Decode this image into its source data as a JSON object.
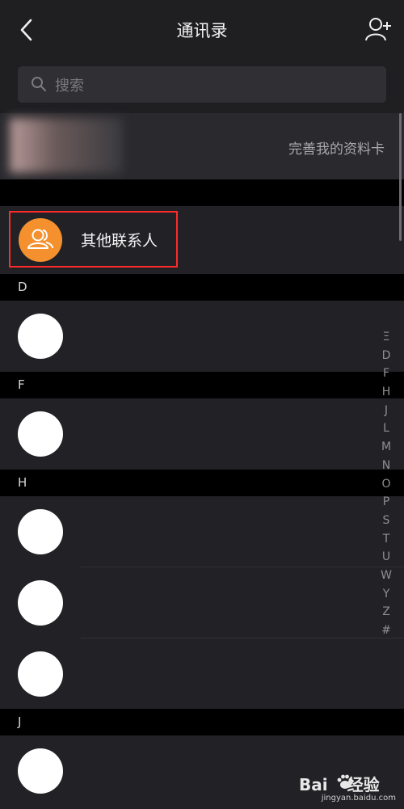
{
  "header": {
    "title": "通讯录",
    "back_icon": "chevron-left-icon",
    "add_icon": "add-contact-icon"
  },
  "search": {
    "placeholder": "搜索"
  },
  "profile": {
    "cta": "完善我的资料卡"
  },
  "other_contacts": {
    "label": "其他联系人",
    "highlight_color": "#ff2a2a",
    "avatar_color": "#f4912e"
  },
  "sections": [
    {
      "letter": "D"
    },
    {
      "letter": "F"
    },
    {
      "letter": "H"
    },
    {
      "letter": "J"
    }
  ],
  "index_bar": [
    "Ξ",
    "D",
    "F",
    "H",
    "J",
    "L",
    "M",
    "N",
    "O",
    "P",
    "S",
    "T",
    "U",
    "W",
    "Y",
    "Z",
    "#"
  ],
  "watermark": {
    "main": "Bai",
    "tail": "经验",
    "sub": "jingyan.baidu.com"
  }
}
